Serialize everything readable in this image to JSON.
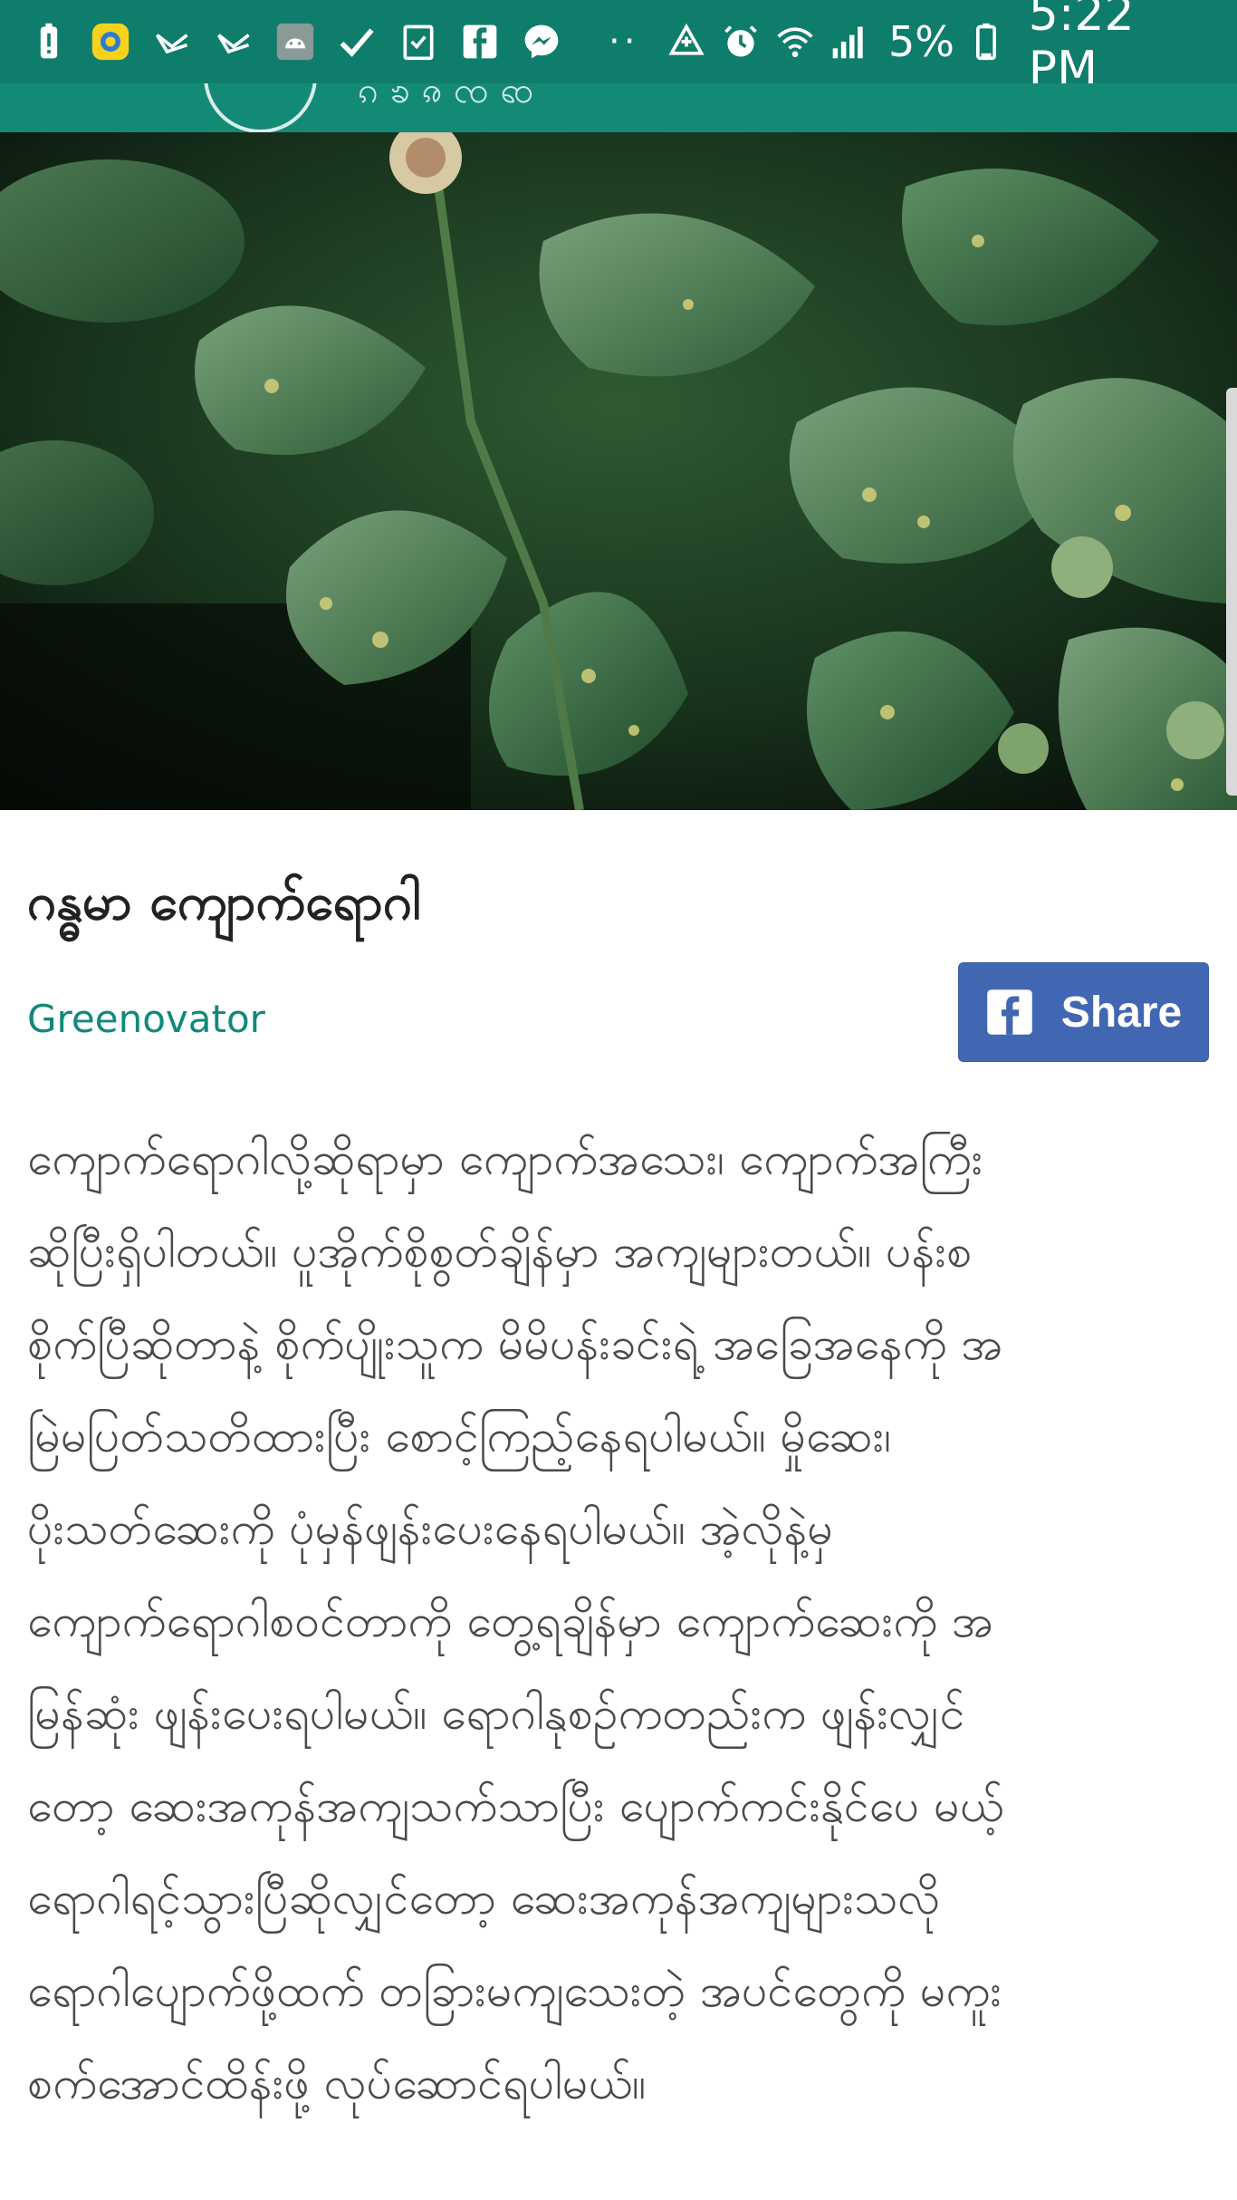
{
  "status_bar": {
    "left_icons": [
      "battery-alert-icon",
      "app-circle-icon",
      "mail-icon",
      "mail-icon",
      "android-icon",
      "check-icon",
      "checklist-icon",
      "facebook-icon",
      "messenger-icon"
    ],
    "overflow_dots": "··",
    "right_icons": [
      "data-saver-icon",
      "alarm-icon",
      "wifi-icon",
      "signal-icon"
    ],
    "battery_percent": "5%",
    "time": "5:22 PM"
  },
  "article": {
    "title": "ဂန္ဓမာ ကျောက်ရောဂါ",
    "author": "Greenovator",
    "share_label": "Share",
    "body_lines": [
      "ကျောက်ရောဂါလို့ဆိုရာမှာ ကျောက်အသေး၊ ကျောက်အကြီး",
      "ဆိုပြီးရှိပါတယ်။ ပူအိုက်စိုစွတ်ချိန်မှာ အကျများတယ်။ ပန်းစ",
      "စိုက်ပြီဆိုတာနဲ့ စိုက်ပျိုးသူက မိမိပန်းခင်းရဲ့ အခြေအနေကို အ",
      "မြဲမပြတ်သတိထားပြီး စောင့်ကြည့်နေရပါမယ်။ မှိုဆေး၊",
      "ပိုးသတ်ဆေးကို ပုံမှန်ဖျန်းပေးနေရပါမယ်။ အဲ့လိုနဲ့မှ",
      "ကျောက်ရောဂါစဝင်တာကို တွေ့ရချိန်မှာ ကျောက်ဆေးကို အ",
      "မြန်ဆုံး ဖျန်းပေးရပါမယ်။ ရောဂါနုစဥ်ကတည်းက ဖျန်းလျှင်",
      "တော့ ဆေးအကုန်အကျသက်သာပြီး ပျောက်ကင်းနိုင်ပေ မယ့်",
      "ရောဂါရင့်သွားပြီဆိုလျှင်တော့ ဆေးအကုန်အကျများသလို",
      "ရောဂါပျောက်ဖို့ထက် တခြားမကျသေးတဲ့ အပင်တွေကို မကူး",
      "စက်အောင်ထိန်းဖို့ လုပ်ဆောင်ရပါမယ်။"
    ]
  }
}
